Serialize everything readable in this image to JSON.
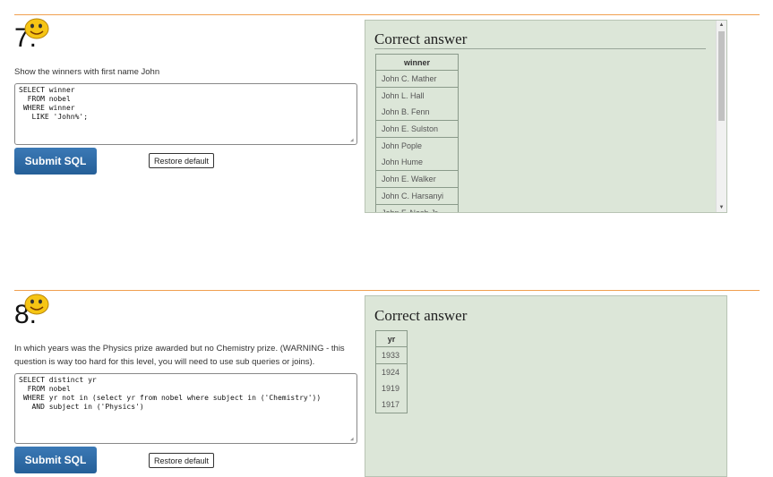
{
  "questions": [
    {
      "number": "7.",
      "prompt": "Show the winners with first name John",
      "sql": "SELECT winner\n  FROM nobel\n WHERE winner\n   LIKE 'John%';",
      "submit_label": "Submit SQL",
      "restore_label": "Restore default",
      "answer_title": "Correct answer",
      "table": {
        "header": "winner",
        "rows": [
          "John C. Mather",
          "John L. Hall",
          "John B. Fenn",
          "John E. Sulston",
          "John Pople",
          "John Hume",
          "John E. Walker",
          "John C. Harsanyi",
          "John F. Nash Jr."
        ]
      }
    },
    {
      "number": "8.",
      "prompt": "In which years was the Physics prize awarded but no Chemistry prize. (WARNING - this question is way too hard for this level, you will need to use sub queries or joins).",
      "sql": "SELECT distinct yr\n  FROM nobel\n WHERE yr not in (select yr from nobel where subject in ('Chemistry'))\n   AND subject in ('Physics')",
      "submit_label": "Submit SQL",
      "restore_label": "Restore default",
      "answer_title": "Correct answer",
      "table": {
        "header": "yr",
        "rows": [
          "1933",
          "1924",
          "1919",
          "1917"
        ]
      }
    }
  ],
  "colors": {
    "rule": "#f0a050",
    "submit_bg": "#2f6ca8",
    "answer_bg": "#dce6d8"
  },
  "icons": {
    "smiley": "smiley-face-icon"
  }
}
